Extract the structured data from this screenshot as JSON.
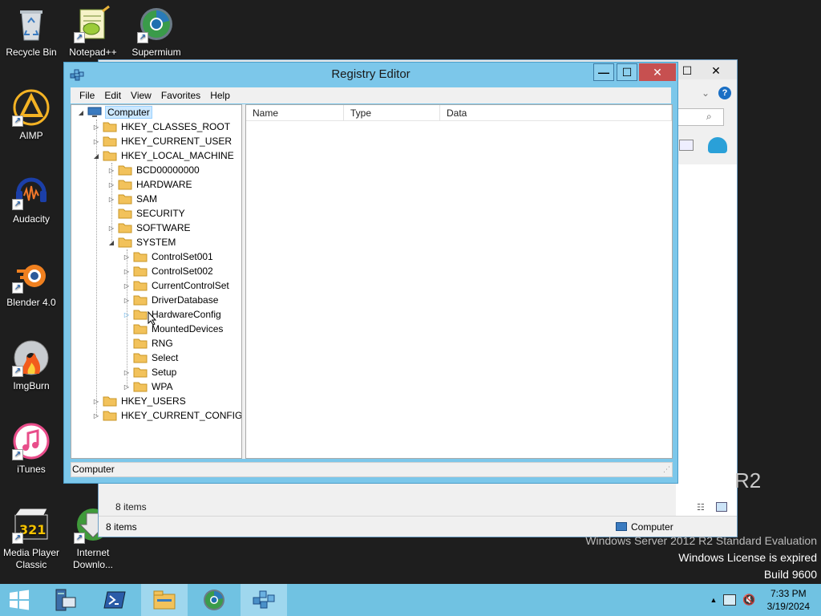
{
  "desktop": {
    "icons": [
      {
        "label": "Recycle Bin",
        "icon": "recycle-bin-icon"
      },
      {
        "label": "Notepad++",
        "icon": "notepad-plus-plus-icon"
      },
      {
        "label": "Supermium",
        "icon": "supermium-icon"
      },
      {
        "label": "AIMP",
        "icon": "aimp-icon"
      },
      {
        "label": "Audacity",
        "icon": "audacity-icon"
      },
      {
        "label": "Blender 4.0",
        "icon": "blender-icon"
      },
      {
        "label": "ImgBurn",
        "icon": "imgburn-icon"
      },
      {
        "label": "iTunes",
        "icon": "itunes-icon"
      },
      {
        "label": "Media Player Classic",
        "icon": "media-player-classic-icon"
      },
      {
        "label": "Internet Downlo...",
        "icon": "internet-download-manager-icon"
      }
    ],
    "watermark": {
      "line1": "Windows Server 2012 R2 Standard Evaluation",
      "line2": "Windows License is expired",
      "line3": "Build 9600"
    },
    "r2_text": "R2"
  },
  "background_window": {
    "status_count": "8 items",
    "status_count_2": "8 items",
    "status_location": "Computer"
  },
  "regedit": {
    "title": "Registry Editor",
    "buttons": {
      "minimize": "—",
      "maximize": "☐",
      "close": "✕"
    },
    "menu": [
      "File",
      "Edit",
      "View",
      "Favorites",
      "Help"
    ],
    "tree": {
      "root": "Computer",
      "hkcr": "HKEY_CLASSES_ROOT",
      "hkcu": "HKEY_CURRENT_USER",
      "hklm": "HKEY_LOCAL_MACHINE",
      "hklm_children": [
        "BCD00000000",
        "HARDWARE",
        "SAM",
        "SECURITY",
        "SOFTWARE",
        "SYSTEM"
      ],
      "system_children": [
        "ControlSet001",
        "ControlSet002",
        "CurrentControlSet",
        "DriverDatabase",
        "HardwareConfig",
        "MountedDevices",
        "RNG",
        "Select",
        "Setup",
        "WPA"
      ],
      "hku": "HKEY_USERS",
      "hkcc": "HKEY_CURRENT_CONFIG"
    },
    "columns": [
      "Name",
      "Type",
      "Data"
    ],
    "status": "Computer"
  },
  "taskbar": {
    "time": "7:33 PM",
    "date": "3/19/2024",
    "colors": {
      "bar": "#70c2e2",
      "active": "#9fd7ee"
    }
  }
}
